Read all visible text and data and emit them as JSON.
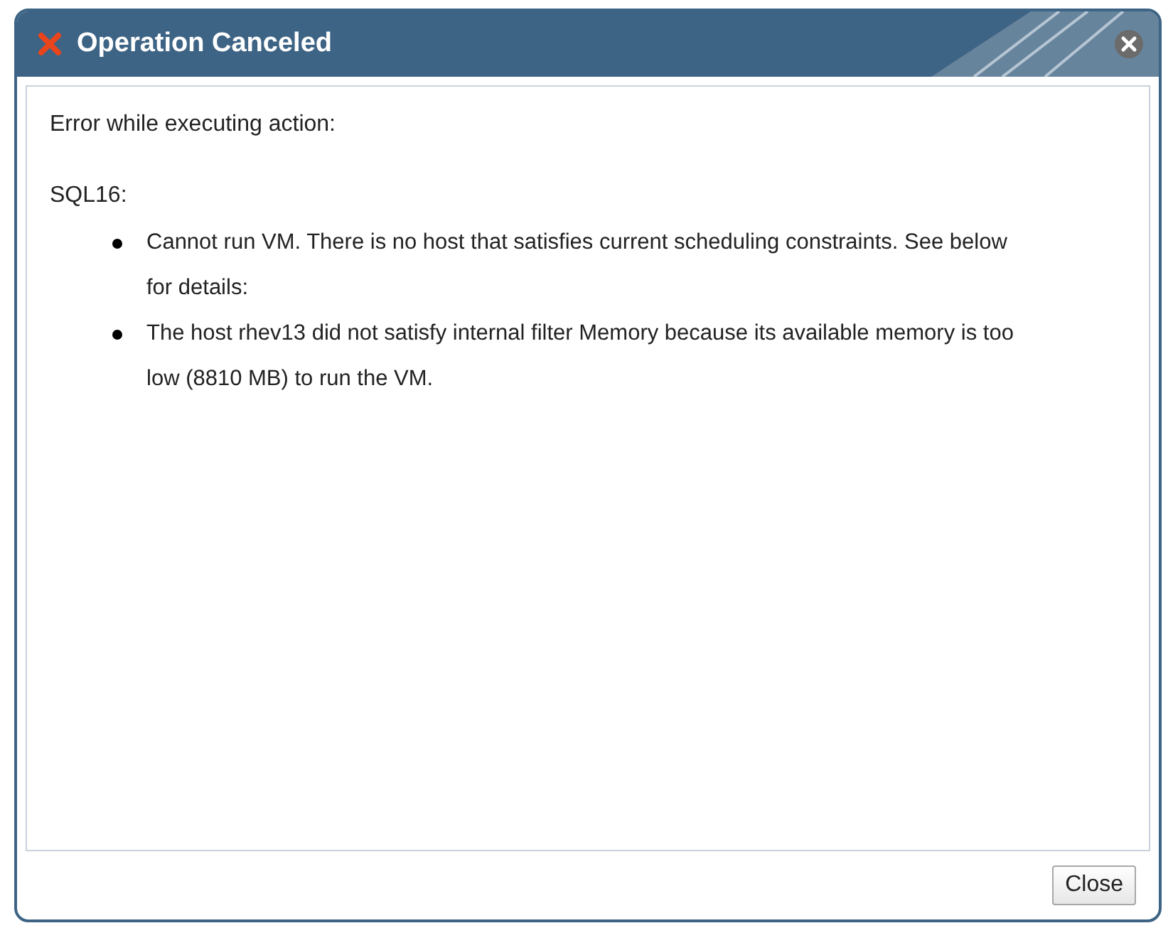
{
  "dialog": {
    "title": "Operation Canceled",
    "message": "Error while executing action:",
    "code": "SQL16:",
    "items": [
      "Cannot run VM. There is no host that satisfies current scheduling constraints. See below for details:",
      "The host rhev13 did not satisfy internal filter Memory because its available memory is too low (8810 MB) to run the VM."
    ],
    "buttons": [
      "Close"
    ]
  }
}
